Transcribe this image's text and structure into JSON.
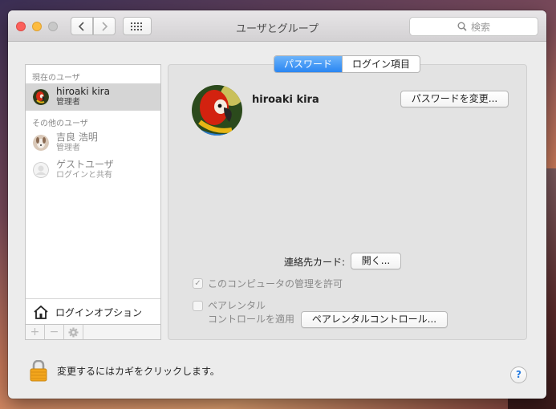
{
  "window": {
    "title": "ユーザとグループ"
  },
  "search": {
    "placeholder": "検索"
  },
  "sidebar": {
    "current_header": "現在のユーザ",
    "other_header": "その他のユーザ",
    "current_user": {
      "name": "hiroaki kira",
      "role": "管理者"
    },
    "other_users": [
      {
        "name": "吉良 浩明",
        "role": "管理者"
      },
      {
        "name": "ゲストユーザ",
        "role": "ログインと共有"
      }
    ],
    "login_options": "ログインオプション",
    "tools": {
      "add": "+",
      "remove": "−"
    }
  },
  "tabs": [
    {
      "label": "パスワード"
    },
    {
      "label": "ログイン項目"
    }
  ],
  "detail": {
    "user_name": "hiroaki kira",
    "change_password": "パスワードを変更...",
    "contact_card_label": "連絡先カード:",
    "open_button": "開く...",
    "admin_check": {
      "label": "このコンピュータの管理を許可",
      "checked": true
    },
    "parental_check": {
      "line1": "ペアレンタル",
      "line2": "コントロールを適用",
      "checked": false
    },
    "parental_button": "ペアレンタルコントロール..."
  },
  "footer": {
    "lock_text": "変更するにはカギをクリックします。",
    "help": "?"
  },
  "colors": {
    "accent": "#2a86f2",
    "close": "#fc605c",
    "minimize": "#fdbc40"
  }
}
